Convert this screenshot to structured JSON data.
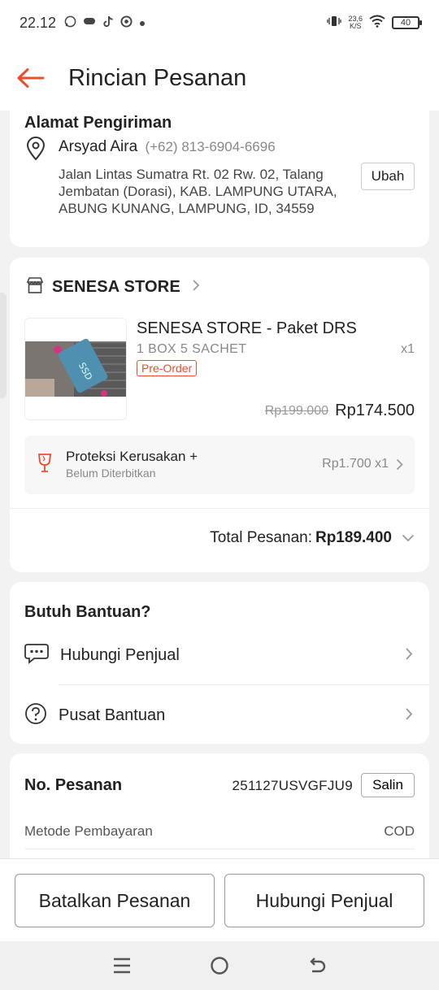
{
  "status_bar": {
    "time": "22.12",
    "net_speed_value": "23,6",
    "net_speed_unit": "K/S",
    "battery": "40"
  },
  "header": {
    "title": "Rincian Pesanan"
  },
  "address": {
    "heading": "Alamat Pengiriman",
    "name": "Arsyad Aira",
    "phone": "(+62) 813-6904-6696",
    "line1": "Jalan Lintas Sumatra Rt. 02 Rw. 02, Talang",
    "line2": "Jembatan (Dorasi), KAB. LAMPUNG UTARA,",
    "line3": "ABUNG KUNANG, LAMPUNG, ID, 34559",
    "edit_label": "Ubah"
  },
  "store": {
    "name": "SENESA STORE",
    "product": {
      "name": "SENESA STORE - Paket DRS",
      "variant": "1 BOX 5 SACHET",
      "qty": "x1",
      "badge": "Pre-Order",
      "price_original": "Rp199.000",
      "price_final": "Rp174.500",
      "image_text": "SSD"
    },
    "protection": {
      "title": "Proteksi Kerusakan +",
      "subtitle": "Belum Diterbitkan",
      "price": "Rp1.700 x1"
    },
    "total_label": "Total Pesanan:",
    "total_amount": "Rp189.400"
  },
  "help": {
    "title": "Butuh Bantuan?",
    "items": [
      {
        "label": "Hubungi Penjual"
      },
      {
        "label": "Pusat Bantuan"
      }
    ]
  },
  "order": {
    "number_label": "No. Pesanan",
    "number": "251127USVGFJU9",
    "copy_label": "Salin",
    "payment_label": "Metode Pembayaran",
    "payment_value": "COD"
  },
  "actions": {
    "cancel_label": "Batalkan Pesanan",
    "contact_label": "Hubungi Penjual"
  },
  "colors": {
    "accent": "#ee4d2d",
    "background": "#f2f2f2"
  }
}
